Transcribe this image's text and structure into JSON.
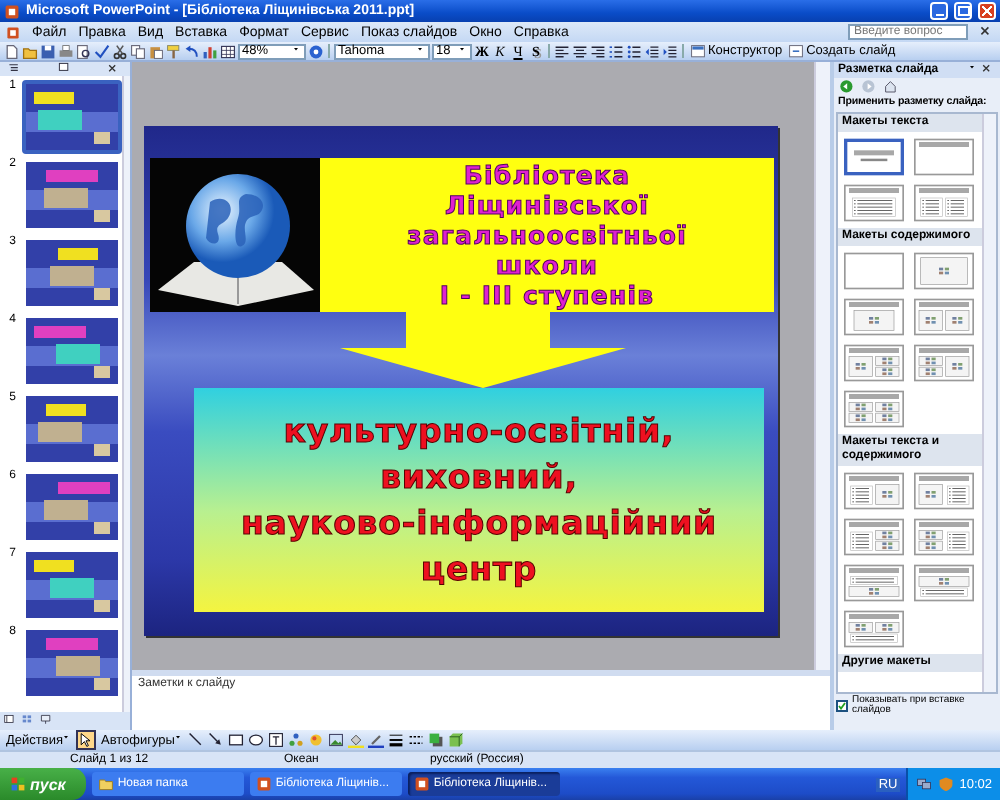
{
  "window": {
    "title": "Microsoft PowerPoint - [Бібліотека Ліщинівська 2011.ppt]"
  },
  "menu": [
    "Файл",
    "Правка",
    "Вид",
    "Вставка",
    "Формат",
    "Сервис",
    "Показ слайдов",
    "Окно",
    "Справка"
  ],
  "help_field": {
    "placeholder": "Введите вопрос"
  },
  "toolbar": {
    "zoom": "48%",
    "font": "Tahoma",
    "font_size": "18",
    "format_buttons": [
      {
        "label": "Ж",
        "kind": "bold"
      },
      {
        "label": "К",
        "kind": "italic"
      },
      {
        "label": "Ч",
        "kind": "underline"
      },
      {
        "label": "S",
        "kind": "shadow"
      }
    ],
    "buttons": [
      {
        "label": "Конструктор",
        "kind": "design"
      },
      {
        "label": "Создать слайд",
        "kind": "new-slide"
      }
    ]
  },
  "slides_pane": {
    "thumbnails": [
      {
        "number": "1",
        "selected": true
      },
      {
        "number": "2",
        "selected": false
      },
      {
        "number": "3",
        "selected": false
      },
      {
        "number": "4",
        "selected": false
      },
      {
        "number": "5",
        "selected": false
      },
      {
        "number": "6",
        "selected": false
      },
      {
        "number": "7",
        "selected": false
      },
      {
        "number": "8",
        "selected": false
      }
    ]
  },
  "slide": {
    "title": "Бібліотека\nЛіщинівської\nзагальноосвітньої\nшколи\nІ - ІІІ ступенів",
    "body": "культурно-освітній,\nвиховний,\nнауково-інформаційний\nцентр"
  },
  "notes": {
    "placeholder": "Заметки к слайду"
  },
  "task_pane": {
    "title": "Разметка слайда",
    "subtitle": "Применить разметку слайда:",
    "sections": [
      {
        "heading": "Макеты текста",
        "layouts": [
          {
            "kind": "title",
            "selected": true
          },
          {
            "kind": "title-only",
            "selected": false
          },
          {
            "kind": "title-text",
            "selected": false
          },
          {
            "kind": "title-2text",
            "selected": false
          }
        ]
      },
      {
        "heading": "Макеты содержимого",
        "layouts": [
          {
            "kind": "blank",
            "selected": false
          },
          {
            "kind": "content",
            "selected": false
          },
          {
            "kind": "title-content",
            "selected": false
          },
          {
            "kind": "title-2content",
            "selected": false
          },
          {
            "kind": "title-content-2content",
            "selected": false
          },
          {
            "kind": "title-2content-content",
            "selected": false
          },
          {
            "kind": "title-4content",
            "selected": false
          }
        ]
      },
      {
        "heading": "Макеты текста и содержимого",
        "layouts": [
          {
            "kind": "title-text-content",
            "selected": false
          },
          {
            "kind": "title-content-text",
            "selected": false
          },
          {
            "kind": "title-text-2content",
            "selected": false
          },
          {
            "kind": "title-2content-text",
            "selected": false
          },
          {
            "kind": "title-text-over-content",
            "selected": false
          },
          {
            "kind": "title-content-over-text",
            "selected": false
          },
          {
            "kind": "title-2content-over-text",
            "selected": false
          }
        ]
      }
    ],
    "more_heading": "Другие макеты",
    "show_on_insert": {
      "label": "Показывать при вставке слайдов",
      "checked": true
    }
  },
  "drawing_toolbar": {
    "actions": "Действия",
    "autoshapes": "Автофигуры"
  },
  "status_bar": {
    "slide": "Слайд 1 из 12",
    "design": "Океан",
    "language": "русский (Россия)"
  },
  "taskbar": {
    "start": "пуск",
    "tasks": [
      {
        "label": "Новая папка",
        "kind": "folder",
        "selected": false
      },
      {
        "label": "Бібліотека Ліщинів...",
        "kind": "powerpoint",
        "selected": false
      },
      {
        "label": "Бібліотека Ліщинів...",
        "kind": "powerpoint",
        "selected": true
      }
    ],
    "language": "RU",
    "clock": "10:02"
  }
}
